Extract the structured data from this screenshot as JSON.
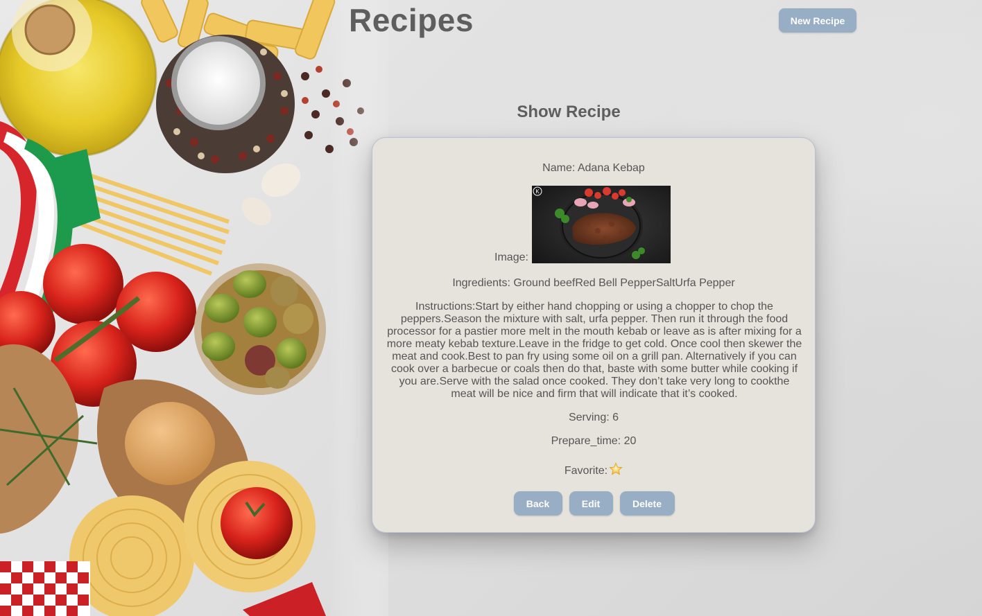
{
  "header": {
    "title": "Recipes",
    "new_recipe_label": "New Recipe"
  },
  "page": {
    "section_title": "Show Recipe"
  },
  "recipe": {
    "name_label": "Name:",
    "name": "Adana Kebap",
    "name_line": "Name: Adana Kebap",
    "image_label": "Image:",
    "ingredients_line": "Ingredients: Ground beefRed Bell PepperSaltUrfa Pepper",
    "instructions_line": "Instructions:Start by either hand chopping or using a chopper to chop the peppers.Season the mixture with salt, urfa pepper. Then run it through the food processor for a pastier more melt in the mouth kebab or leave as is after mixing for a more meaty kebab texture.Leave in the fridge to get cold. Once cool then skewer the meat and cook.Best to pan fry using some oil on a grill pan. Alternatively if you can cook over a barbecue or coals then do that, baste with some butter while cooking if you are.Serve with the salad once cooked. They don’t take very long to cookthe meat will be nice and firm that will indicate that it’s cooked.",
    "serving_line": "Serving: 6",
    "prepare_time_line": "Prepare_time: 20",
    "favorite_label": "Favorite:",
    "favorite_icon": "star-icon",
    "image_watermark": "K"
  },
  "actions": {
    "back_label": "Back",
    "edit_label": "Edit",
    "delete_label": "Delete"
  },
  "colors": {
    "button": "#97aec5",
    "card": "#e6e2dc",
    "title": "#5e5e5e",
    "text": "#555555"
  }
}
